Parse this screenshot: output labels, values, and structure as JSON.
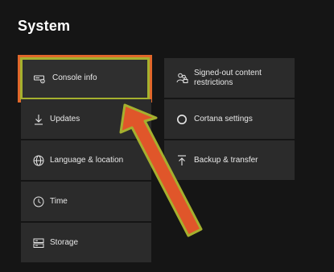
{
  "page": {
    "title": "System"
  },
  "left_column": [
    {
      "label": "Console info",
      "icon": "console-icon",
      "selected": true
    },
    {
      "label": "Updates",
      "icon": "download-icon",
      "selected": false
    },
    {
      "label": "Language & location",
      "icon": "globe-icon",
      "selected": false
    },
    {
      "label": "Time",
      "icon": "clock-icon",
      "selected": false
    },
    {
      "label": "Storage",
      "icon": "storage-icon",
      "selected": false
    }
  ],
  "right_column": [
    {
      "label": "Signed-out content restrictions",
      "icon": "people-lock-icon"
    },
    {
      "label": "Cortana settings",
      "icon": "cortana-icon"
    },
    {
      "label": "Backup & transfer",
      "icon": "upload-icon"
    }
  ],
  "annotation": {
    "arrow_fill": "#e0562a",
    "arrow_stroke": "#a5b02e",
    "highlight_color": "#e0672a"
  }
}
